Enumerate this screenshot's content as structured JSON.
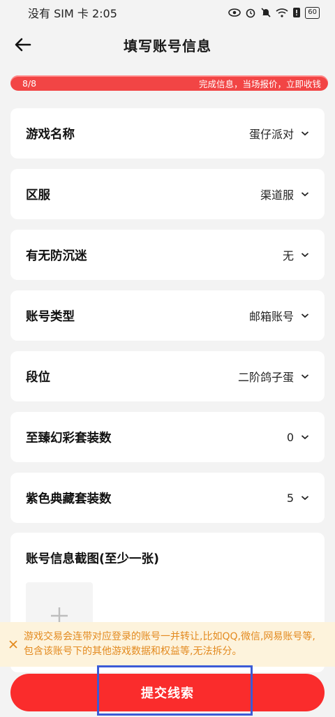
{
  "status_bar": {
    "carrier_time": "没有 SIM 卡 2:05",
    "battery": "60"
  },
  "header": {
    "title": "填写账号信息"
  },
  "progress": {
    "step": "8/8",
    "percent": 100,
    "hint": "完成信息，当场报价，立即收钱"
  },
  "fields": [
    {
      "label": "游戏名称",
      "value": "蛋仔派对"
    },
    {
      "label": "区服",
      "value": "渠道服"
    },
    {
      "label": "有无防沉迷",
      "value": "无"
    },
    {
      "label": "账号类型",
      "value": "邮箱账号"
    },
    {
      "label": "段位",
      "value": "二阶鸽子蛋"
    },
    {
      "label": "至臻幻彩套装数",
      "value": "0"
    },
    {
      "label": "紫色典藏套装数",
      "value": "5"
    }
  ],
  "upload": {
    "label": "账号信息截图(至少一张)"
  },
  "notice": {
    "text": "游戏交易会连带对应登录的账号一并转让,比如QQ,微信,网易账号等,包含该账号下的其他游戏数据和权益等,无法拆分。"
  },
  "submit": {
    "label": "提交线索"
  },
  "colors": {
    "accent": "#fa2c2c",
    "notice_text": "#e38a1f",
    "notice_bg": "#fdf3dc",
    "highlight": "#3b5bd6"
  }
}
